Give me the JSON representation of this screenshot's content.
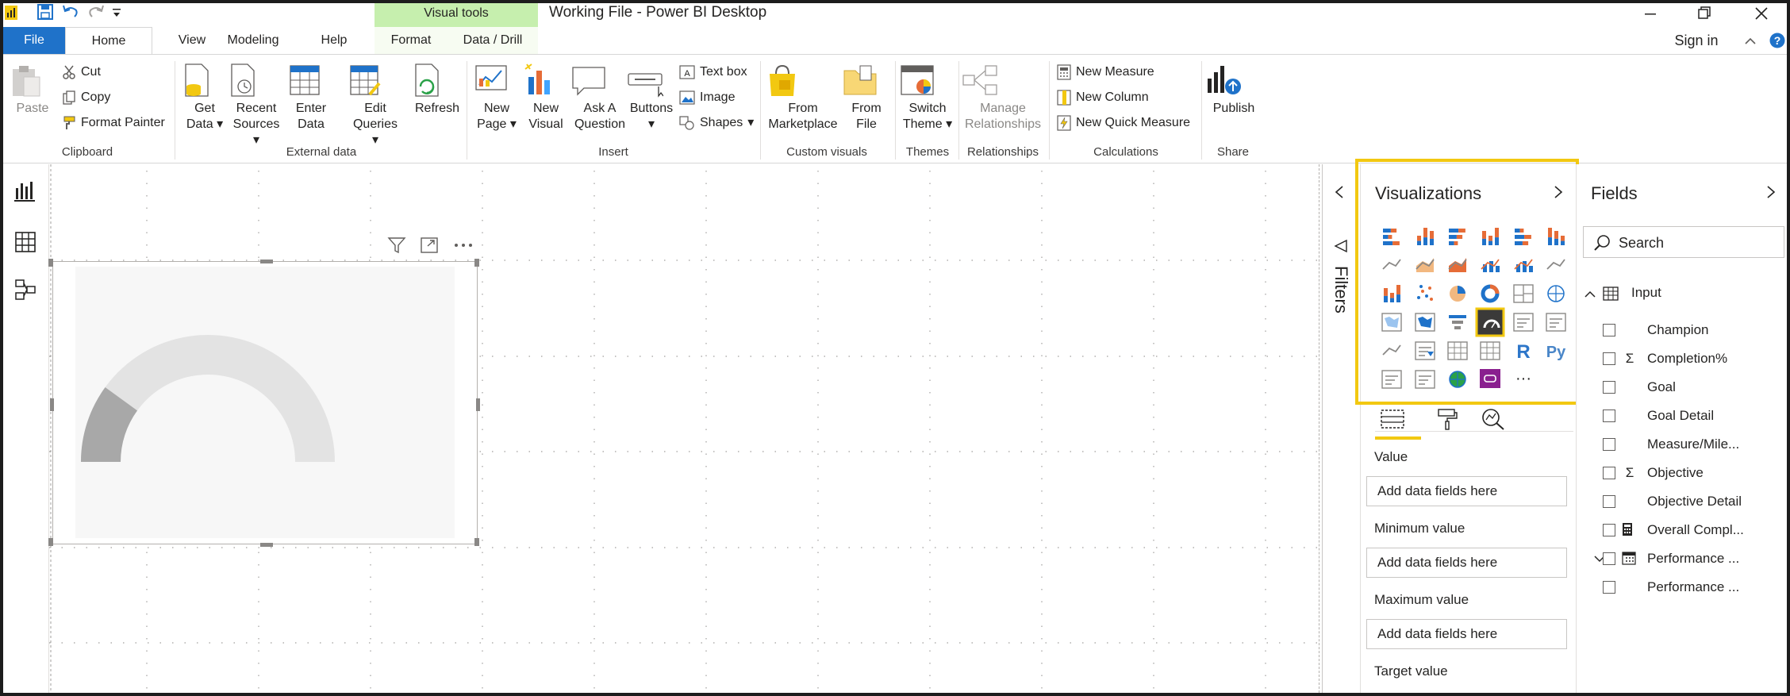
{
  "window": {
    "title": "Working File - Power BI Desktop",
    "contextual_group": "Visual tools",
    "sign_in": "Sign in"
  },
  "tabs": [
    {
      "label": "File"
    },
    {
      "label": "Home"
    },
    {
      "label": "View"
    },
    {
      "label": "Modeling"
    },
    {
      "label": "Help"
    },
    {
      "label": "Format"
    },
    {
      "label": "Data / Drill"
    }
  ],
  "ribbon": {
    "clipboard": {
      "label": "Clipboard",
      "paste": "Paste",
      "cut": "Cut",
      "copy": "Copy",
      "format_painter": "Format Painter"
    },
    "external_data": {
      "label": "External data",
      "get_data_1": "Get",
      "get_data_2": "Data",
      "recent_sources_1": "Recent",
      "recent_sources_2": "Sources",
      "enter_data_1": "Enter",
      "enter_data_2": "Data",
      "edit_queries_1": "Edit",
      "edit_queries_2": "Queries",
      "refresh": "Refresh"
    },
    "insert": {
      "label": "Insert",
      "new_page_1": "New",
      "new_page_2": "Page",
      "new_visual_1": "New",
      "new_visual_2": "Visual",
      "ask_question_1": "Ask A",
      "ask_question_2": "Question",
      "buttons": "Buttons",
      "text_box": "Text box",
      "image": "Image",
      "shapes": "Shapes"
    },
    "custom_visuals": {
      "label": "Custom visuals",
      "from_marketplace_1": "From",
      "from_marketplace_2": "Marketplace",
      "from_file_1": "From",
      "from_file_2": "File"
    },
    "themes": {
      "label": "Themes",
      "switch_theme_1": "Switch",
      "switch_theme_2": "Theme"
    },
    "relationships": {
      "label": "Relationships",
      "manage_1": "Manage",
      "manage_2": "Relationships"
    },
    "calculations": {
      "label": "Calculations",
      "new_measure": "New Measure",
      "new_column": "New Column",
      "new_quick_measure": "New Quick Measure"
    },
    "share": {
      "label": "Share",
      "publish": "Publish"
    }
  },
  "gauge": {
    "value_fraction": 0.2
  },
  "filters_pane": {
    "label": "Filters"
  },
  "visualizations_pane": {
    "title": "Visualizations",
    "wells": [
      {
        "label": "Value",
        "placeholder": "Add data fields here"
      },
      {
        "label": "Minimum value",
        "placeholder": "Add data fields here"
      },
      {
        "label": "Maximum value",
        "placeholder": "Add data fields here"
      },
      {
        "label": "Target value"
      }
    ],
    "more": "···",
    "r_label": "R",
    "py_label": "Py"
  },
  "fields_pane": {
    "title": "Fields",
    "search_placeholder": "Search",
    "table": "Input",
    "fields": [
      {
        "name": "Champion",
        "icon": ""
      },
      {
        "name": "Completion%",
        "icon": "Σ"
      },
      {
        "name": "Goal",
        "icon": ""
      },
      {
        "name": "Goal Detail",
        "icon": ""
      },
      {
        "name": "Measure/Mile...",
        "icon": ""
      },
      {
        "name": "Objective",
        "icon": "Σ"
      },
      {
        "name": "Objective Detail",
        "icon": ""
      },
      {
        "name": "Overall Compl...",
        "icon": "calculator-icon"
      },
      {
        "name": "Performance ...",
        "icon": "calendar-icon"
      },
      {
        "name": "Performance ...",
        "icon": ""
      }
    ]
  },
  "colors": {
    "accent": "#f2c811",
    "file_tab": "#1f72c9",
    "visual_tools": "#c6efae",
    "gauge_fill": "#a8a8a8",
    "gauge_track": "#e3e3e3"
  }
}
